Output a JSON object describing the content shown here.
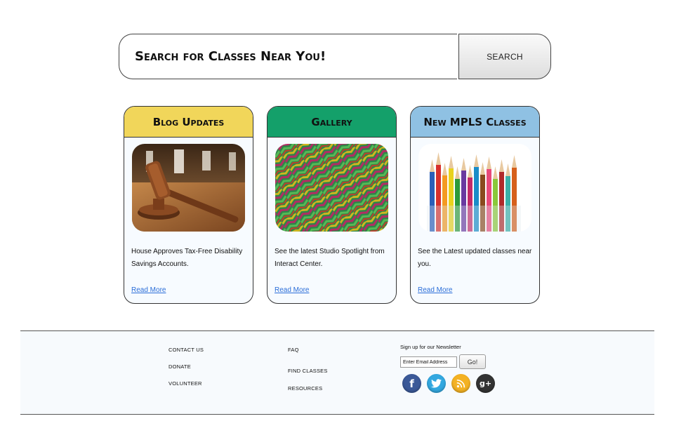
{
  "search": {
    "placeholder": "Search for Classes Near You!",
    "button_label": "SEARCH"
  },
  "cards": [
    {
      "title": "Blog Updates",
      "header_color": "#f1d65a",
      "image": "gavel-image",
      "text": "House Approves Tax-Free Disability Savings Accounts.",
      "link": "Read More"
    },
    {
      "title": "Gallery",
      "header_color": "#14a06a",
      "image": "woven-artwork-image",
      "text": "See the latest Studio Spotlight from Interact Center.",
      "link": "Read More"
    },
    {
      "title": "New MPLS Classes",
      "header_color": "#8fc1e3",
      "image": "colored-pencils-image",
      "text": "See the Latest updated classes near you.",
      "link": "Read More"
    }
  ],
  "footer": {
    "col1": [
      "CONTACT US",
      "DONATE",
      "VOLUNTEER"
    ],
    "col2": [
      "FAQ",
      "FIND CLASSES",
      "RESOURCES"
    ],
    "newsletter": {
      "label": "Sign up for our Newsletter",
      "placeholder": "Enter Email Address",
      "button": "Go!"
    },
    "social": [
      {
        "name": "facebook-icon",
        "glyph": "f",
        "color": "#3b5998"
      },
      {
        "name": "twitter-icon",
        "glyph": "🐦",
        "color": "#33a8e0"
      },
      {
        "name": "rss-icon",
        "glyph": "rss",
        "color": "#f4b223"
      },
      {
        "name": "google-plus-icon",
        "glyph": "g+",
        "color": "#333333"
      }
    ]
  }
}
